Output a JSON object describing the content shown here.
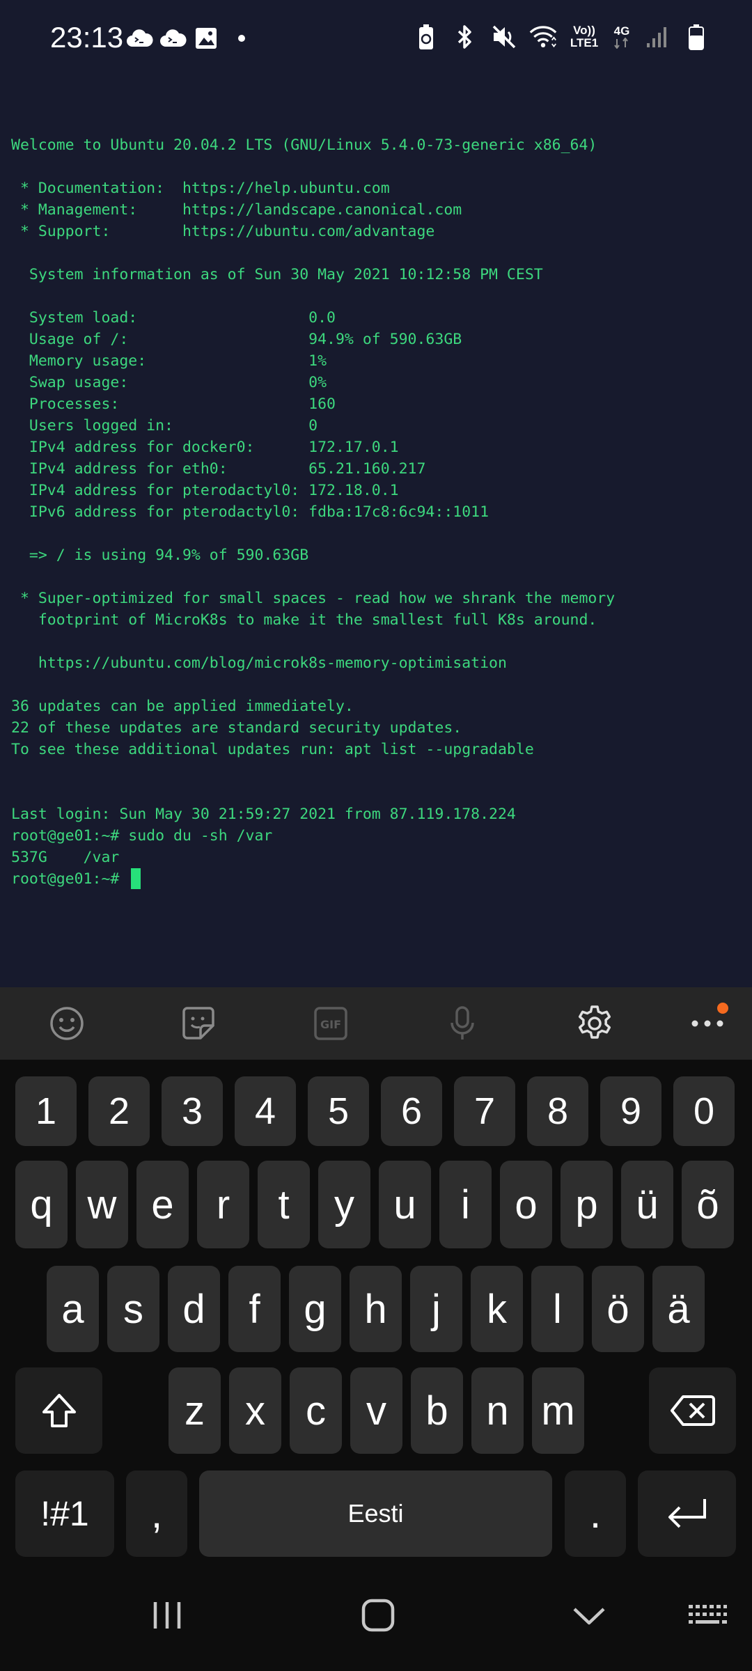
{
  "status_bar": {
    "time": "23:13",
    "left_icons": [
      "terminal-cloud-icon",
      "terminal-cloud-icon",
      "image-icon",
      "dot-icon"
    ],
    "network_label_top": "Vo))",
    "network_label_bottom": "LTE1",
    "network_type": "4G",
    "right_icons": [
      "battery-saver-icon",
      "bluetooth-icon",
      "mute-icon",
      "wifi-icon",
      "volte-icon",
      "4g-icon",
      "signal-icon",
      "battery-icon"
    ]
  },
  "terminal": {
    "lines": [
      "Welcome to Ubuntu 20.04.2 LTS (GNU/Linux 5.4.0-73-generic x86_64)",
      "",
      " * Documentation:  https://help.ubuntu.com",
      " * Management:     https://landscape.canonical.com",
      " * Support:        https://ubuntu.com/advantage",
      "",
      "  System information as of Sun 30 May 2021 10:12:58 PM CEST",
      "",
      "  System load:                   0.0",
      "  Usage of /:                    94.9% of 590.63GB",
      "  Memory usage:                  1%",
      "  Swap usage:                    0%",
      "  Processes:                     160",
      "  Users logged in:               0",
      "  IPv4 address for docker0:      172.17.0.1",
      "  IPv4 address for eth0:         65.21.160.217",
      "  IPv4 address for pterodactyl0: 172.18.0.1",
      "  IPv6 address for pterodactyl0: fdba:17c8:6c94::1011",
      "",
      "  => / is using 94.9% of 590.63GB",
      "",
      " * Super-optimized for small spaces - read how we shrank the memory",
      "   footprint of MicroK8s to make it the smallest full K8s around.",
      "",
      "   https://ubuntu.com/blog/microk8s-memory-optimisation",
      "",
      "36 updates can be applied immediately.",
      "22 of these updates are standard security updates.",
      "To see these additional updates run: apt list --upgradable",
      "",
      "",
      "Last login: Sun May 30 21:59:27 2021 from 87.119.178.224",
      "root@ge01:~# sudo du -sh /var",
      "537G    /var"
    ],
    "prompt": "root@ge01:~# "
  },
  "toolbar": {
    "items": [
      "emoji-icon",
      "sticker-icon",
      "gif-icon",
      "microphone-icon",
      "settings-icon",
      "more-icon"
    ],
    "accent_dot_color": "#f56a1f"
  },
  "keyboard": {
    "number_row": [
      "1",
      "2",
      "3",
      "4",
      "5",
      "6",
      "7",
      "8",
      "9",
      "0"
    ],
    "row1": [
      "q",
      "w",
      "e",
      "r",
      "t",
      "y",
      "u",
      "i",
      "o",
      "p",
      "ü",
      "õ"
    ],
    "row2": [
      "a",
      "s",
      "d",
      "f",
      "g",
      "h",
      "j",
      "k",
      "l",
      "ö",
      "ä"
    ],
    "row3": [
      "z",
      "x",
      "c",
      "v",
      "b",
      "n",
      "m"
    ],
    "symbols_label": "!#1",
    "comma_label": ",",
    "space_label": "Eesti",
    "period_label": "."
  },
  "colors": {
    "terminal_bg": "#171a2d",
    "terminal_text": "#3dd87e",
    "keyboard_bg": "#0d0d0d",
    "key_bg": "#2e2e2e"
  }
}
